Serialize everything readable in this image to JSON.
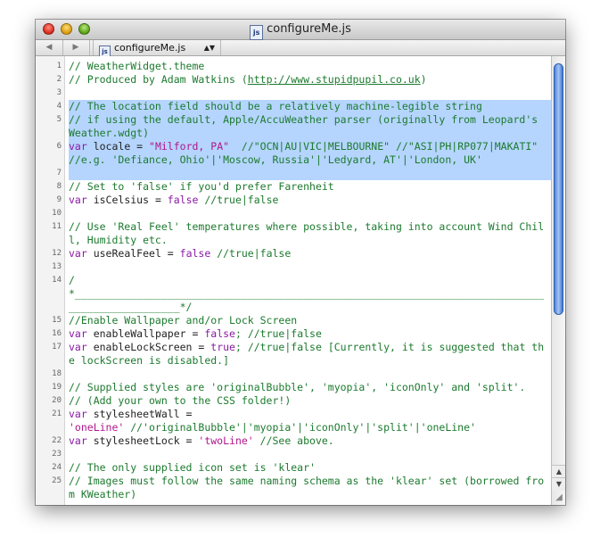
{
  "window": {
    "title": "configureMe.js",
    "file_badge": "js",
    "nav_back": "◀",
    "nav_forward": "▶",
    "file_popup": "configureMe.js",
    "popup_arrows": "▲▼"
  },
  "scrollbar": {
    "up_arrow": "▲",
    "down_arrow": "▼",
    "resize_glyph": "◢"
  },
  "code": [
    {
      "num": "1",
      "segs": [
        {
          "t": "// WeatherWidget.theme",
          "c": "c"
        }
      ]
    },
    {
      "num": "2",
      "segs": [
        {
          "t": "// Produced by Adam Watkins (",
          "c": "c"
        },
        {
          "t": "http://www.stupidpupil.co.uk",
          "c": "u"
        },
        {
          "t": ")",
          "c": "c"
        }
      ]
    },
    {
      "num": "3",
      "segs": []
    },
    {
      "num": "4",
      "sel": true,
      "segs": [
        {
          "t": "// The location field should be a relatively machine-legible string",
          "c": "c"
        }
      ]
    },
    {
      "num": "5",
      "sel": true,
      "segs": [
        {
          "t": "// if using the default, Apple/AccuWeather parser (originally from Leopard's Weather.wdgt)",
          "c": "c"
        }
      ]
    },
    {
      "num": "6",
      "sel": true,
      "segs": [
        {
          "t": "var",
          "c": "k"
        },
        {
          "t": " locale = ",
          "c": ""
        },
        {
          "t": "\"Milford, PA\"",
          "c": "s"
        },
        {
          "t": "  //\"OCN|AU|VIC|MELBOURNE\" //\"ASI|PH|RP077|MAKATI\" //e.g. 'Defiance, Ohio'|'Moscow, Russia'|'Ledyard, AT'|'London, UK'",
          "c": "c"
        }
      ]
    },
    {
      "num": "7",
      "sel": true,
      "segs": []
    },
    {
      "num": "8",
      "segs": [
        {
          "t": "// Set to 'false' if you'd prefer Farenheit",
          "c": "c"
        }
      ]
    },
    {
      "num": "9",
      "segs": [
        {
          "t": "var",
          "c": "k"
        },
        {
          "t": " isCelsius = ",
          "c": ""
        },
        {
          "t": "false",
          "c": "k"
        },
        {
          "t": " //true|false",
          "c": "c"
        }
      ]
    },
    {
      "num": "10",
      "segs": []
    },
    {
      "num": "11",
      "segs": [
        {
          "t": "// Use 'Real Feel' temperatures where possible, taking into account Wind Chill, Humidity etc.",
          "c": "c"
        }
      ]
    },
    {
      "num": "12",
      "segs": [
        {
          "t": "var",
          "c": "k"
        },
        {
          "t": " useRealFeel = ",
          "c": ""
        },
        {
          "t": "false",
          "c": "k"
        },
        {
          "t": " //true|false",
          "c": "c"
        }
      ]
    },
    {
      "num": "13",
      "segs": []
    },
    {
      "num": "14",
      "segs": [
        {
          "t": "/\n*______________________________________________________________________________________________*/",
          "c": "c"
        }
      ]
    },
    {
      "num": "15",
      "segs": [
        {
          "t": "//Enable Wallpaper and/or Lock Screen",
          "c": "c"
        }
      ]
    },
    {
      "num": "16",
      "segs": [
        {
          "t": "var",
          "c": "k"
        },
        {
          "t": " enableWallpaper = ",
          "c": ""
        },
        {
          "t": "false",
          "c": "k"
        },
        {
          "t": "; //true|false",
          "c": "c"
        }
      ]
    },
    {
      "num": "17",
      "segs": [
        {
          "t": "var",
          "c": "k"
        },
        {
          "t": " enableLockScreen = ",
          "c": ""
        },
        {
          "t": "true",
          "c": "k"
        },
        {
          "t": "; //true|false [Currently, it is suggested that the lockScreen is disabled.]",
          "c": "c"
        }
      ]
    },
    {
      "num": "18",
      "segs": []
    },
    {
      "num": "19",
      "segs": [
        {
          "t": "// Supplied styles are 'originalBubble', 'myopia', 'iconOnly' and 'split'.",
          "c": "c"
        }
      ]
    },
    {
      "num": "20",
      "segs": [
        {
          "t": "// (Add your own to the CSS folder!)",
          "c": "c"
        }
      ]
    },
    {
      "num": "21",
      "segs": [
        {
          "t": "var",
          "c": "k"
        },
        {
          "t": " stylesheetWall =\n",
          "c": ""
        },
        {
          "t": "'oneLine'",
          "c": "s"
        },
        {
          "t": " //'originalBubble'|'myopia'|'iconOnly'|'split'|'oneLine'",
          "c": "c"
        }
      ]
    },
    {
      "num": "22",
      "segs": [
        {
          "t": "var",
          "c": "k"
        },
        {
          "t": " stylesheetLock = ",
          "c": ""
        },
        {
          "t": "'twoLine'",
          "c": "s"
        },
        {
          "t": " //See above.",
          "c": "c"
        }
      ]
    },
    {
      "num": "23",
      "segs": []
    },
    {
      "num": "24",
      "segs": [
        {
          "t": "// The only supplied icon set is 'klear'",
          "c": "c"
        }
      ]
    },
    {
      "num": "25",
      "segs": [
        {
          "t": "// Images must follow the same naming schema as the 'klear' set (borrowed from KWeather)",
          "c": "c"
        }
      ]
    }
  ]
}
